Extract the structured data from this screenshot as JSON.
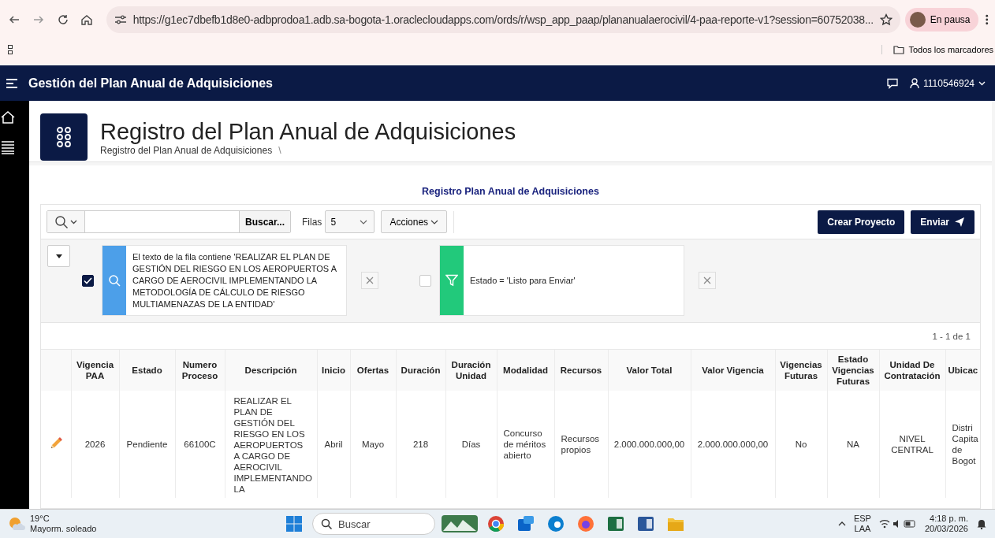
{
  "browser": {
    "url": "https://g1ec7dbefb1d8e0-adbprodoa1.adb.sa-bogota-1.oraclecloudapps.com/ords/r/wsp_app_paap/plananualaerocivil/4-paa-reporte-v1?session=60752038...",
    "profile": "En pausa",
    "bookmarks": "Todos los marcadores"
  },
  "app": {
    "title": "Gestión del Plan Anual de Adquisiciones",
    "user": "1110546924"
  },
  "page": {
    "title": "Registro del Plan Anual de Adquisiciones",
    "breadcrumb": "Registro del Plan Anual de Adquisiciones",
    "separator": "\\"
  },
  "region_title": "Registro Plan Anual de Adquisiciones",
  "toolbar": {
    "search_button": "Buscar...",
    "rows_label": "Filas",
    "rows_value": "5",
    "actions": "Acciones",
    "buttons": [
      {
        "label": "Crear Proyecto",
        "kind": "plain"
      },
      {
        "label": "Enviar",
        "kind": "send"
      }
    ]
  },
  "filters": [
    {
      "kind": "search",
      "checked": true,
      "text": "El texto de la fila contiene 'REALIZAR EL PLAN DE GESTIÓN DEL RIESGO EN LOS AEROPUERTOS A CARGO DE AEROCIVIL IMPLEMENTANDO LA METODOLOGÍA DE CÁLCULO DE RIESGO MULTIAMENAZAS DE LA ENTIDAD'"
    },
    {
      "kind": "filter",
      "checked": false,
      "text": "Estado = 'Listo para Enviar'"
    }
  ],
  "pagination": "1 - 1 de 1",
  "table": {
    "columns": [
      "Vigencia PAA",
      "Estado",
      "Numero Proceso",
      "Descripción",
      "Inicio",
      "Ofertas",
      "Duración",
      "Duración Unidad",
      "Modalidad",
      "Recursos",
      "Valor Total",
      "Valor Vigencia",
      "Vigencias Futuras",
      "Estado Vigencias Futuras",
      "Unidad De Contratación",
      "Ubicac"
    ],
    "rows": [
      {
        "cells": [
          "2026",
          "Pendiente",
          "66100C",
          "REALIZAR EL PLAN DE GESTIÓN DEL RIESGO EN LOS AEROPUERTOS A CARGO DE AEROCIVIL IMPLEMENTANDO LA",
          "Abril",
          "Mayo",
          "218",
          "Días",
          "Concurso de méritos abierto",
          "Recursos propios",
          "2.000.000.000,00",
          "2.000.000.000,00",
          "No",
          "NA",
          "NIVEL CENTRAL",
          "Distri Capita de Bogot"
        ]
      }
    ]
  },
  "taskbar": {
    "temperature": "19°C",
    "weather": "Mayorm. soleado",
    "search": "Buscar",
    "language": "ESP",
    "layout": "LAA",
    "time": "4:18 p. m.",
    "date": "20/03/2026"
  }
}
